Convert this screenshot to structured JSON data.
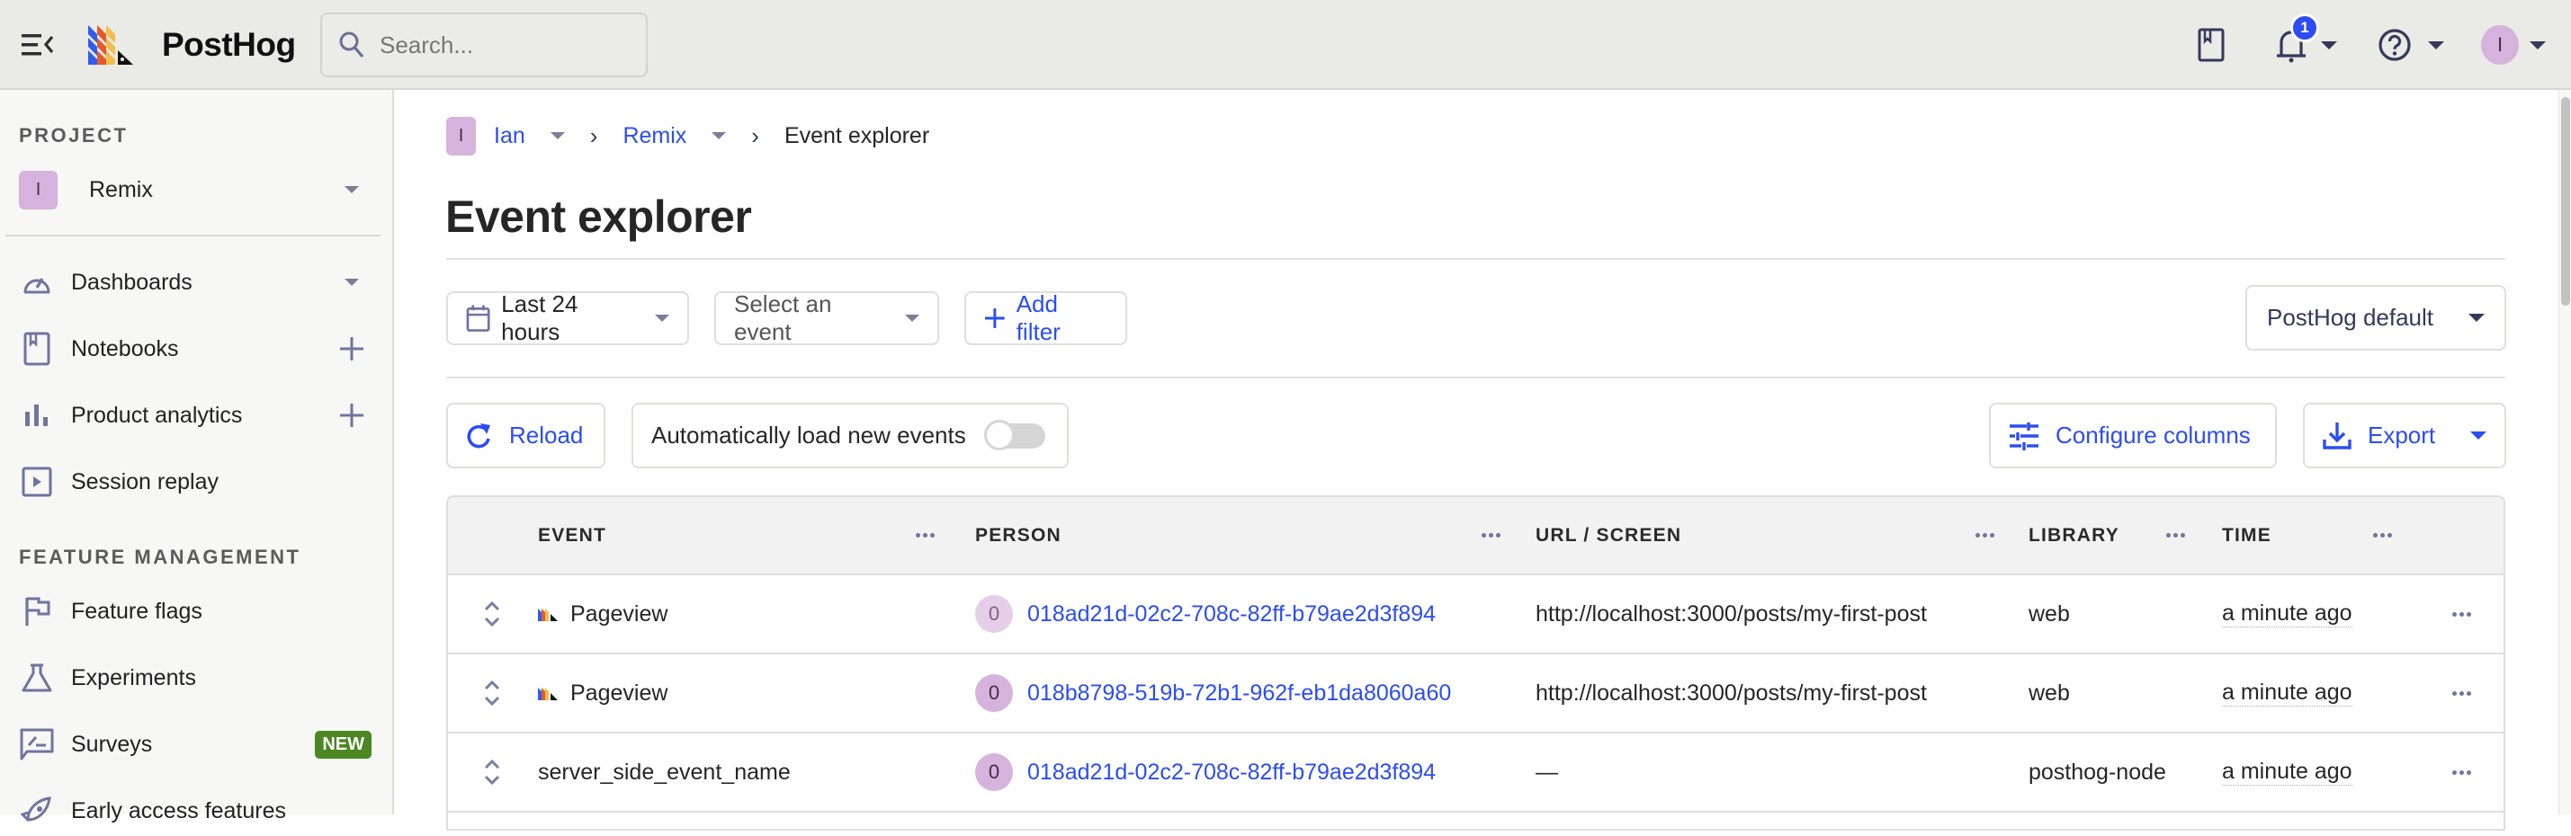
{
  "topbar": {
    "logo_text": "PostHog",
    "search_placeholder": "Search...",
    "notification_count": "1",
    "user_initial": "I"
  },
  "sidebar": {
    "project_label": "PROJECT",
    "project": {
      "initial": "I",
      "name": "Remix"
    },
    "items": [
      {
        "label": "Dashboards",
        "icon": "gauge-icon",
        "end": "caret"
      },
      {
        "label": "Notebooks",
        "icon": "notebook-icon",
        "end": "plus"
      },
      {
        "label": "Product analytics",
        "icon": "bar-chart-icon",
        "end": "plus"
      },
      {
        "label": "Session replay",
        "icon": "play-square-icon",
        "end": ""
      }
    ],
    "feature_section_label": "FEATURE MANAGEMENT",
    "feature_items": [
      {
        "label": "Feature flags",
        "icon": "flag-icon",
        "badge": ""
      },
      {
        "label": "Experiments",
        "icon": "flask-icon",
        "badge": ""
      },
      {
        "label": "Surveys",
        "icon": "survey-icon",
        "badge": "NEW"
      },
      {
        "label": "Early access features",
        "icon": "rocket-icon",
        "badge": ""
      }
    ]
  },
  "breadcrumb": {
    "org_initial": "I",
    "org": "Ian",
    "project": "Remix",
    "current": "Event explorer"
  },
  "page": {
    "title": "Event explorer"
  },
  "filters": {
    "date_range": "Last 24 hours",
    "event_select_placeholder": "Select an event",
    "add_filter": "Add filter",
    "column_preset": "PostHog default"
  },
  "actions": {
    "reload": "Reload",
    "auto_load": "Automatically load new events",
    "auto_load_enabled": false,
    "configure_columns": "Configure columns",
    "export": "Export"
  },
  "table": {
    "columns": [
      "EVENT",
      "PERSON",
      "URL / SCREEN",
      "LIBRARY",
      "TIME"
    ],
    "rows": [
      {
        "event": "Pageview",
        "event_icon": true,
        "person_initial": "0",
        "person": "018ad21d-02c2-708c-82ff-b79ae2d3f894",
        "url": "http://localhost:3000/posts/my-first-post",
        "library": "web",
        "time": "a minute ago"
      },
      {
        "event": "Pageview",
        "event_icon": true,
        "person_initial": "0",
        "person": "018b8798-519b-72b1-962f-eb1da8060a60",
        "url": "http://localhost:3000/posts/my-first-post",
        "library": "web",
        "time": "a minute ago"
      },
      {
        "event": "server_side_event_name",
        "event_icon": false,
        "person_initial": "0",
        "person": "018ad21d-02c2-708c-82ff-b79ae2d3f894",
        "url": "—",
        "library": "posthog-node",
        "time": "a minute ago"
      }
    ]
  },
  "colors": {
    "accent": "#2c4cf5",
    "new_badge": "#4d8724",
    "avatar": "#d6b3dd"
  }
}
